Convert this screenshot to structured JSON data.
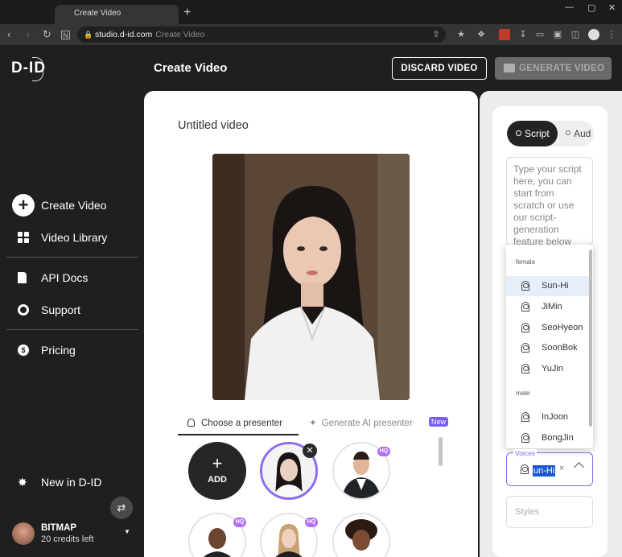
{
  "browser": {
    "tab_title": "Create Video",
    "new_tab": "+",
    "url_domain": "studio.d-id.com",
    "url_page": "Create Video"
  },
  "app": {
    "logo": "D-ID",
    "page_title": "Create Video",
    "discard_label": "DISCARD VIDEO",
    "generate_label": "GENERATE VIDEO"
  },
  "sidebar": {
    "items": [
      {
        "label": "Create Video",
        "icon": "plus-circle-icon"
      },
      {
        "label": "Video Library",
        "icon": "grid-icon"
      },
      {
        "label": "API Docs",
        "icon": "document-icon"
      },
      {
        "label": "Support",
        "icon": "lifebuoy-icon"
      },
      {
        "label": "Pricing",
        "icon": "dollar-icon"
      }
    ],
    "new_in": "New in D-ID",
    "user": {
      "name": "BITMAP",
      "credits": "20 credits left"
    }
  },
  "main": {
    "video_title": "Untitled video",
    "tabs": [
      {
        "label": "Choose a presenter"
      },
      {
        "label": "Generate AI presenter",
        "badge": "New"
      }
    ],
    "add_label": "ADD",
    "presenters": [
      {
        "hq": ""
      },
      {
        "hq": "HQ"
      },
      {
        "hq": "HQ"
      },
      {
        "hq": "HQ"
      },
      {
        "hq": ""
      }
    ]
  },
  "right": {
    "tabs": {
      "script": "Script",
      "audio": "Aud"
    },
    "script_placeholder": "Type your script here, you can start from scratch or use our script-generation feature below",
    "voice_groups": {
      "female": "female",
      "male": "male"
    },
    "female_voices": [
      "Sun-Hi",
      "JiMin",
      "SeoHyeon",
      "SoonBok",
      "YuJin"
    ],
    "male_voices": [
      "InJoon",
      "BongJin"
    ],
    "voices_label": "Voices",
    "voices_value": "un-Hi",
    "voices_clear": "×",
    "styles_placeholder": "Styles"
  },
  "colors": {
    "accent": "#7b5cf0",
    "hq_badge": "#b270f5",
    "dark_bg": "#1f1f1f"
  }
}
